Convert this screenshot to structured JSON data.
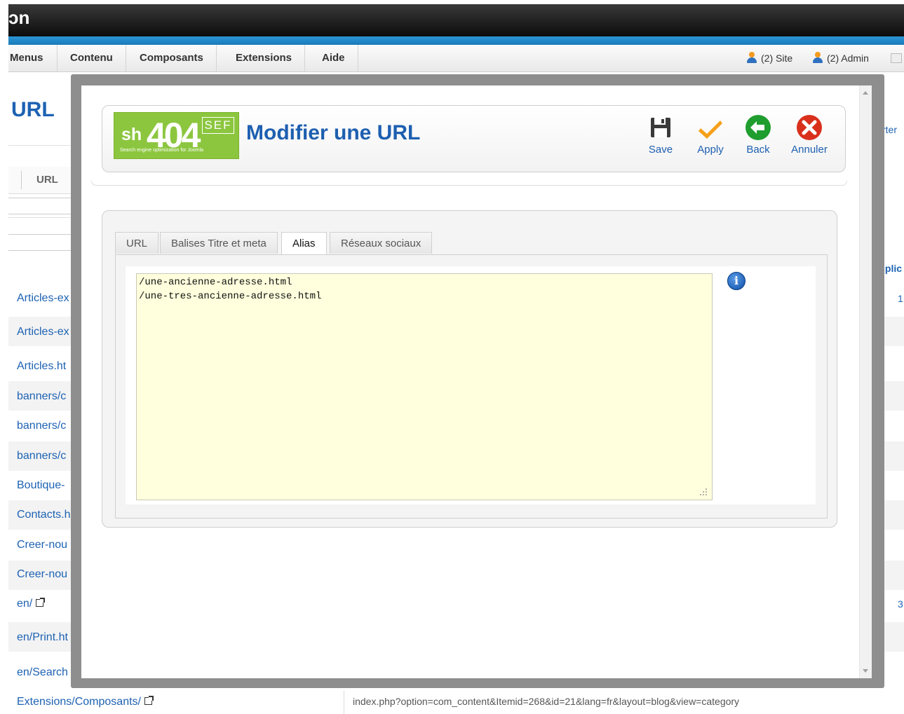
{
  "top_bar": {
    "title_fragment": "ɔn"
  },
  "main_menu": {
    "items": [
      "Menus",
      "Contenu",
      "Composants",
      "Extensions",
      "Aide"
    ],
    "site_label": "(2) Site",
    "admin_label": "(2) Admin"
  },
  "background_page": {
    "heading_fragment": "URL",
    "table_header_url": "URL",
    "right_header_fragment": "rter",
    "right_col_fragment": "iplic",
    "right_numbers": [
      "1",
      "3"
    ],
    "rows": [
      "Articles-ex",
      "Articles-ex",
      "Articles.ht",
      "banners/c",
      "banners/c",
      "banners/c",
      "Boutique-",
      "Contacts.h",
      "Creer-nou",
      "Creer-nou",
      "en/",
      "en/Print.ht",
      "en/Search",
      "Extensions/Composants/"
    ],
    "bottom_url": "index.php?option=com_content&Itemid=268&id=21&lang=fr&layout=blog&view=category"
  },
  "modal": {
    "logo": {
      "sh": "sh",
      "num": "404",
      "sef": "SEF",
      "tagline": "Search engine optimization for Joomla"
    },
    "title": "Modifier une URL",
    "toolbar": {
      "save_label": "Save",
      "apply_label": "Apply",
      "back_label": "Back",
      "cancel_label": "Annuler"
    },
    "tabs": [
      "URL",
      "Balises Titre et meta",
      "Alias",
      "Réseaux sociaux"
    ],
    "active_tab": "Alias",
    "alias_text": "/une-ancienne-adresse.html\n/une-tres-ancienne-adresse.html"
  },
  "colors": {
    "link_blue": "#1d62b3",
    "logo_green": "#8cc63f",
    "alias_background": "#ffffdd",
    "apply_orange": "#f5a01a",
    "back_green": "#1f9d2e",
    "cancel_red": "#d9301c"
  }
}
